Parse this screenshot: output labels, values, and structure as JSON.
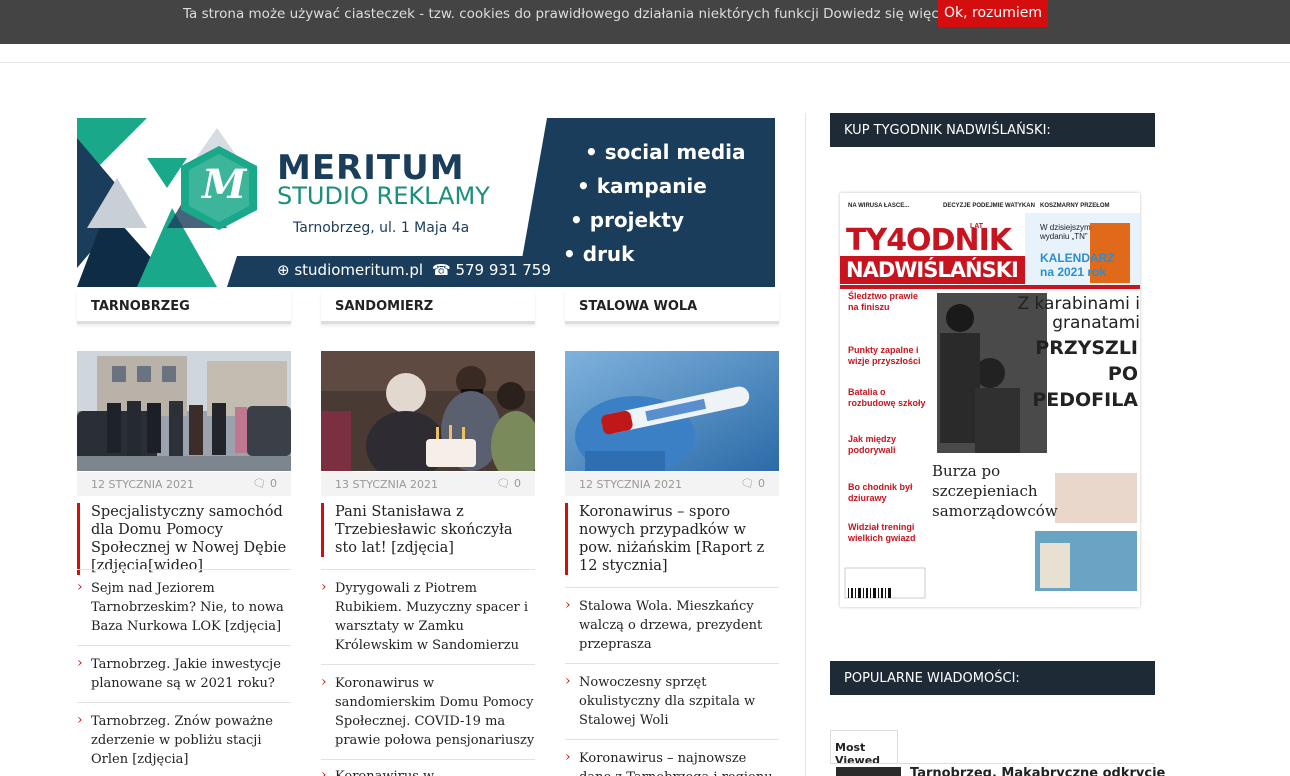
{
  "cookie": {
    "text": "Ta strona może używać ciasteczek - tzw. cookies do prawidłowego działania niektórych funkcji",
    "link": "Dowiedz się więcej",
    "button": "Ok, rozumiem"
  },
  "banner": {
    "title": "MERITUM",
    "subtitle": "STUDIO REKLAMY",
    "address": "Tarnobrzeg, ul. 1 Maja 4a",
    "website": "studiomeritum.pl",
    "phone": "579 931 759",
    "services": [
      "• social media",
      "• kampanie",
      "• projekty",
      "• druk"
    ],
    "logo_letter": "M"
  },
  "columns": [
    {
      "heading": "TARNOBRZEG",
      "date": "12 STYCZNIA 2021",
      "comments": "0",
      "lead": "Specjalistyczny samochód dla Domu Pomocy Społecznej w Nowej Dębie [zdjęcia[wideo]",
      "items": [
        "Sejm nad Jeziorem Tarnobrzeskim? Nie, to nowa Baza Nurkowa LOK [zdjęcia]",
        "Tarnobrzeg. Jakie inwestycje planowane są w 2021 roku?",
        "Tarnobrzeg. Znów poważne zderzenie w pobliżu stacji Orlen [zdjęcia]"
      ]
    },
    {
      "heading": "SANDOMIERZ",
      "date": "13 STYCZNIA 2021",
      "comments": "0",
      "lead": "Pani Stanisława z Trzebiesławic skończyła sto lat! [zdjęcia]",
      "items": [
        "Dyrygowali z Piotrem Rubikiem. Muzyczny spacer i warsztaty w Zamku Królewskim w Sandomierzu",
        "Koronawirus w sandomierskim Domu Pomocy Społecznej. COVID-19 ma prawie połowa pensjonariuszy",
        "Koronawirus w lubiwsiańskim..."
      ]
    },
    {
      "heading": "STALOWA WOLA",
      "date": "12 STYCZNIA 2021",
      "comments": "0",
      "lead": "Koronawirus – sporo nowych przypadków w pow. niżańskim [Raport z 12 stycznia]",
      "items": [
        "Stalowa Wola. Mieszkańcy walczą o drzewa, prezydent przeprasza",
        "Nowoczesny sprzęt okulistyczny dla szpitala w Stalowej Woli",
        "Koronawirus – najnowsze dane z Tarnobrzega i regionu [Raport"
      ]
    }
  ],
  "sidebar": {
    "buy_heading": "KUP TYGODNIK NADWIŚLAŃSKI:",
    "popular_heading": "POPULARNE WIADOMOŚCI:",
    "most_viewed_tab": "Most Viewed",
    "most_viewed_first": "Tarnobrzeg. Makabryczne odkrycie"
  },
  "cover": {
    "masthead_top": "TY4ODNIK",
    "masthead_bottom": "NADWIŚLAŃSKI",
    "lat": "LAT",
    "calendar": "KALENDARZ na 2021 rok",
    "calendar_intro": "W dzisiejszym wydaniu „TN”",
    "headline1": "Z karabinami i granatami",
    "headline2": "PRZYSZLI PO PEDOFILA",
    "headline3": "Burza po szczepieniach samorządowców",
    "left_items": [
      "Śledztwo prawie na finiszu",
      "Punkty zapalne i wizje przyszłości",
      "Batalia o rozbudowę szkoły",
      "Jak między podorywali",
      "Bo chodnik był dziurawy",
      "Widział treningi wielkich gwiazd"
    ],
    "top_labels": [
      "NA WIRUSA ŁASCE...",
      "DECYZJE PODEJMIE WATYKAN",
      "KOSZMARNY PRZEŁOM"
    ]
  },
  "colors": {
    "accent": "#d40e0e",
    "navy": "#1e2a36",
    "banner_navy": "#1a3d5c",
    "banner_teal": "#1a8f7a"
  }
}
